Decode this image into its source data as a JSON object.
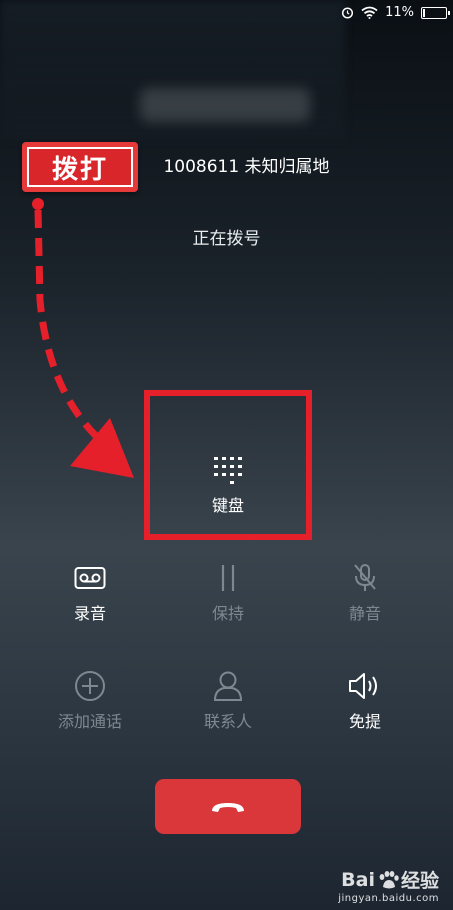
{
  "status_bar": {
    "battery_text": "11%",
    "battery_level": 0.11
  },
  "caller": {
    "number_location": "1008611 未知归属地",
    "status": "正在拨号"
  },
  "annotation": {
    "label": "拨打",
    "color": "#e6202a"
  },
  "buttons": {
    "keypad": "键盘",
    "record": "录音",
    "hold": "保持",
    "mute": "静音",
    "add_call": "添加通话",
    "contacts": "联系人",
    "speaker": "免提"
  },
  "end_call_color": "#d9373a",
  "watermark": {
    "brand_left": "Bai",
    "brand_right": "经验",
    "url": "jingyan.baidu.com"
  }
}
